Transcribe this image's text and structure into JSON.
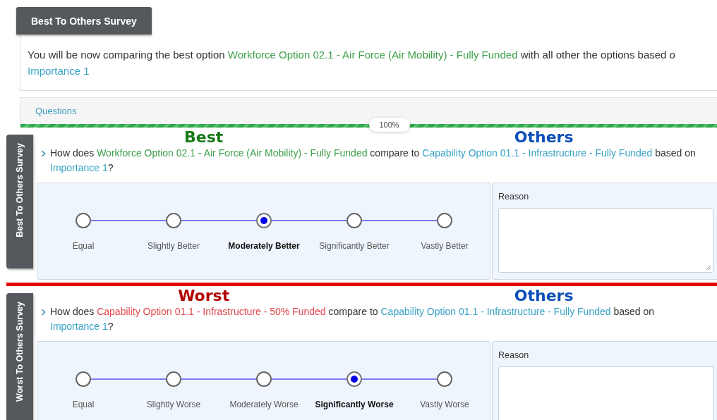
{
  "header_tab": "Best To Others Survey",
  "intro": [
    [
      {
        "text": "You will be now comparing the best option ",
        "kind": "plain"
      },
      {
        "text": "Workforce Option 02.1 - Air Force (Air Mobility) - Fully Funded",
        "kind": "best"
      },
      {
        "text": " with all other the options based o",
        "kind": "plain"
      }
    ],
    [
      {
        "text": "Importance 1",
        "kind": "other"
      }
    ]
  ],
  "questions_tab": "Questions",
  "progress": {
    "label": "100%",
    "level": 1
  },
  "sections": [
    {
      "kind": "best",
      "tab_label": "Best To Others Survey",
      "left_heading": "Best",
      "right_heading": "Others",
      "question": [
        {
          "text": "How does ",
          "kind": "plain"
        },
        {
          "text": "Workforce Option 02.1 - Air Force (Air Mobility) - Fully Funded",
          "kind": "best"
        },
        {
          "text": " compare to ",
          "kind": "plain"
        },
        {
          "text": "Capability Option 01.1 - Infrastructure - Fully Funded",
          "kind": "other"
        },
        {
          "text": " based on ",
          "kind": "plain"
        },
        {
          "text": "Importance 1",
          "kind": "other"
        },
        {
          "text": "?",
          "kind": "plain"
        }
      ],
      "scale": [
        {
          "label": "Equal",
          "selected": false
        },
        {
          "label": "Slightly Better",
          "selected": false
        },
        {
          "label": "Moderately Better",
          "selected": true
        },
        {
          "label": "Significantly Better",
          "selected": false
        },
        {
          "label": "Vastly Better",
          "selected": false
        }
      ],
      "reason_label": "Reason"
    },
    {
      "kind": "worst",
      "tab_label": "Worst To Others Survey",
      "left_heading": "Worst",
      "right_heading": "Others",
      "question": [
        {
          "text": "How does ",
          "kind": "plain"
        },
        {
          "text": "Capability Option 01.1 - Infrastructure - 50% Funded",
          "kind": "worst"
        },
        {
          "text": " compare to ",
          "kind": "plain"
        },
        {
          "text": "Capability Option 01.1 - Infrastructure - Fully Funded",
          "kind": "other"
        },
        {
          "text": " based on ",
          "kind": "plain"
        },
        {
          "text": "Importance 1",
          "kind": "other"
        },
        {
          "text": "?",
          "kind": "plain"
        }
      ],
      "scale": [
        {
          "label": "Equal",
          "selected": false
        },
        {
          "label": "Slightly Worse",
          "selected": false
        },
        {
          "label": "Moderately Worse",
          "selected": false
        },
        {
          "label": "Significantly Worse",
          "selected": true
        },
        {
          "label": "Vastly Worse",
          "selected": false
        }
      ],
      "reason_label": "Reason"
    }
  ]
}
